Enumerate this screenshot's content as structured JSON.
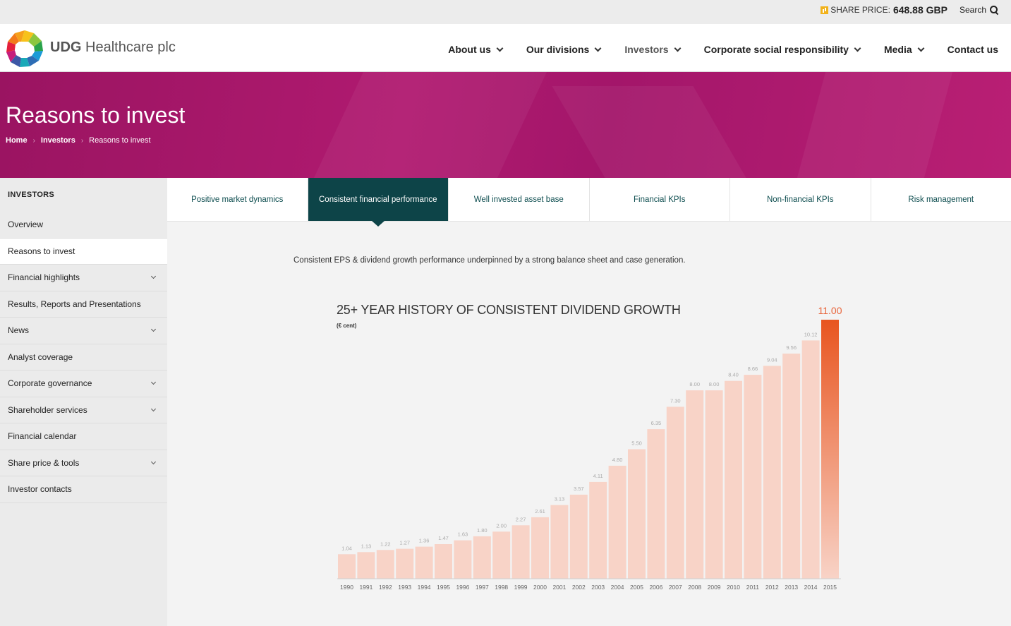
{
  "topbar": {
    "share_label": "SHARE PRICE:",
    "share_value": "648.88 GBP",
    "search_label": "Search"
  },
  "header": {
    "brand_bold": "UDG",
    "brand_rest": "Healthcare plc",
    "nav": [
      {
        "label": "About us",
        "has_menu": true
      },
      {
        "label": "Our divisions",
        "has_menu": true
      },
      {
        "label": "Investors",
        "has_menu": true
      },
      {
        "label": "Corporate social responsibility",
        "has_menu": true
      },
      {
        "label": "Media",
        "has_menu": true
      },
      {
        "label": "Contact us",
        "has_menu": false
      }
    ]
  },
  "banner": {
    "title": "Reasons to invest",
    "breadcrumbs": [
      "Home",
      "Investors",
      "Reasons to invest"
    ],
    "color": "#a8176c"
  },
  "sidebar": {
    "title": "INVESTORS",
    "items": [
      {
        "label": "Overview",
        "expandable": false
      },
      {
        "label": "Reasons to invest",
        "expandable": false
      },
      {
        "label": "Financial highlights",
        "expandable": true
      },
      {
        "label": "Results, Reports and Presentations",
        "expandable": false
      },
      {
        "label": "News",
        "expandable": true
      },
      {
        "label": "Analyst coverage",
        "expandable": false
      },
      {
        "label": "Corporate governance",
        "expandable": true
      },
      {
        "label": "Shareholder services",
        "expandable": true
      },
      {
        "label": "Financial calendar",
        "expandable": false
      },
      {
        "label": "Share price & tools",
        "expandable": true
      },
      {
        "label": "Investor contacts",
        "expandable": false
      }
    ]
  },
  "tabs": [
    "Positive market dynamics",
    "Consistent financial performance",
    "Well invested asset base",
    "Financial KPIs",
    "Non-financial KPIs",
    "Risk management"
  ],
  "content": {
    "intro": "Consistent EPS & dividend growth performance underpinned by a strong balance sheet and case generation."
  },
  "chart_data": {
    "type": "bar",
    "title": "25+ YEAR HISTORY OF CONSISTENT DIVIDEND GROWTH",
    "subtitle": "(€ cent)",
    "categories": [
      "1990",
      "1991",
      "1992",
      "1993",
      "1994",
      "1995",
      "1996",
      "1997",
      "1998",
      "1999",
      "2000",
      "2001",
      "2002",
      "2003",
      "2004",
      "2005",
      "2006",
      "2007",
      "2008",
      "2009",
      "2010",
      "2011",
      "2012",
      "2013",
      "2014",
      "2015"
    ],
    "values": [
      1.04,
      1.13,
      1.22,
      1.27,
      1.36,
      1.47,
      1.63,
      1.8,
      2.0,
      2.27,
      2.61,
      3.13,
      3.57,
      4.11,
      4.8,
      5.5,
      6.35,
      7.3,
      8.0,
      8.0,
      8.4,
      8.66,
      9.04,
      9.56,
      10.12,
      11.0
    ],
    "value_labels": [
      "1.04",
      "1.13",
      "1.22",
      "1.27",
      "1.36",
      "1.47",
      "1.63",
      "1.80",
      "2.00",
      "2.27",
      "2.61",
      "3.13",
      "3.57",
      "4.11",
      "4.80",
      "5.50",
      "6.35",
      "7.30",
      "8.00",
      "8.00",
      "8.40",
      "8.66",
      "9.04",
      "9.56",
      "10.12",
      "11.00"
    ],
    "ylim": [
      0,
      11
    ],
    "grid": false,
    "colors": {
      "bar": "#f8d3c7",
      "highlight": "#e8551f",
      "label": "#aaaaaa",
      "highlight_label": "#e8643a"
    }
  }
}
